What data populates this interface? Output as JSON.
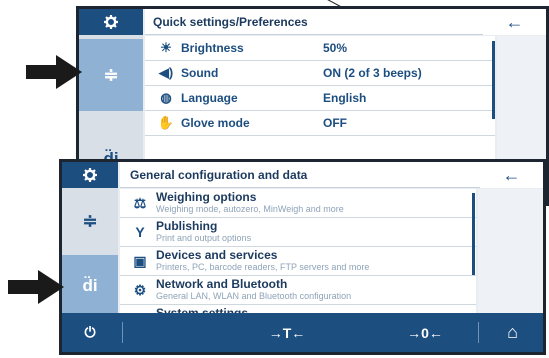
{
  "back_screen": {
    "header_title": "Quick settings/Preferences",
    "rows": [
      {
        "icon": "sun-icon",
        "glyph": "☀",
        "label": "Brightness",
        "value": "50%"
      },
      {
        "icon": "speaker-icon",
        "glyph": "🔊",
        "label": "Sound",
        "value": "ON (2 of 3 beeps)"
      },
      {
        "icon": "globe-icon",
        "glyph": "🌐",
        "label": "Language",
        "value": "English"
      },
      {
        "icon": "glove-icon",
        "glyph": "✋",
        "label": "Glove mode",
        "value": "OFF"
      }
    ]
  },
  "front_screen": {
    "header_title": "General configuration and data",
    "rows": [
      {
        "icon": "scale-icon",
        "glyph": "⚖",
        "title": "Weighing options",
        "subtitle": "Weighing mode, autozero, MinWeigh and more"
      },
      {
        "icon": "publish-icon",
        "glyph": "Y",
        "title": "Publishing",
        "subtitle": "Print and output options"
      },
      {
        "icon": "devices-icon",
        "glyph": "▣",
        "title": "Devices and services",
        "subtitle": "Printers, PC, barcode readers, FTP servers and more"
      },
      {
        "icon": "network-icon",
        "glyph": "⚙",
        "title": "Network and Bluetooth",
        "subtitle": "General LAN, WLAN and Bluetooth configuration"
      },
      {
        "icon": "system-icon",
        "glyph": "⚙",
        "title": "System settings",
        "subtitle": ""
      }
    ],
    "footer": {
      "power": "⏻",
      "tare": "→T←",
      "zero": "→0←",
      "home": "⌂"
    }
  },
  "icons": {
    "gear": "✿",
    "tuning": "≑",
    "sliders": "ı̣ıı",
    "back": "←"
  },
  "colors": {
    "brand": "#1c4e80",
    "active_tab": "#8fb2d4",
    "frame": "#1d2530"
  }
}
